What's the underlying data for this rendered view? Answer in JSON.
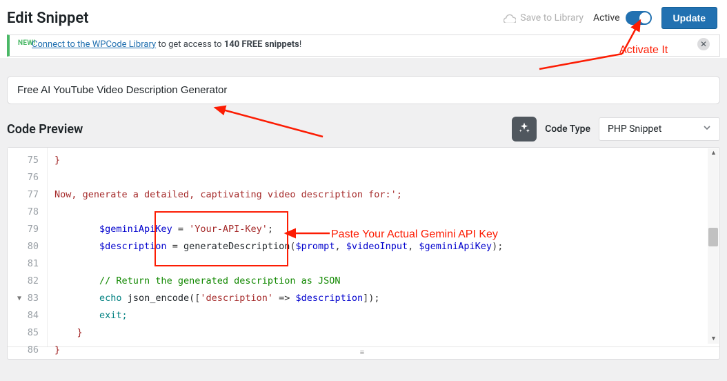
{
  "header": {
    "page_title": "Edit Snippet",
    "save_to_library": "Save to Library",
    "active_label": "Active",
    "update_label": "Update"
  },
  "banner": {
    "new_tag": "NEW!",
    "link_text": "Connect to the WPCode Library",
    "rest_text": " to get access to ",
    "bold_text": "140 FREE snippets",
    "tail_text": "!"
  },
  "title_input": {
    "value": "Free AI YouTube Video Description Generator"
  },
  "preview": {
    "heading": "Code Preview",
    "code_type_label": "Code Type",
    "code_type_value": "PHP Snippet"
  },
  "gutter": [
    "75",
    "76",
    "77",
    "78",
    "79",
    "80",
    "81",
    "82",
    "83",
    "84",
    "85",
    "86"
  ],
  "lines": {
    "l75": "}",
    "l77": "Now, generate a detailed, captivating video description for:';",
    "l79_var": "$geminiApiKey",
    "l79_op": " = ",
    "l79_str": "'Your-API-Key'",
    "l79_end": ";",
    "l80_var": "$description",
    "l80_op": " = ",
    "l80_fn": "generateDescription",
    "l80_p1": "$prompt",
    "l80_p2": "$videoInput",
    "l80_p3": "$geminiApiKey",
    "l82_comment": "// Return the generated description as JSON",
    "l83_a": "echo",
    "l83_b": "json_encode",
    "l83_str": "'description'",
    "l83_var": "$description",
    "l84": "exit;",
    "l85": "}",
    "l86": "}"
  },
  "annotations": {
    "activate_it": "Activate It",
    "paste_key": "Paste Your Actual Gemini API Key"
  },
  "colors": {
    "accent": "#2271b1",
    "annotation": "#fc1c03"
  }
}
